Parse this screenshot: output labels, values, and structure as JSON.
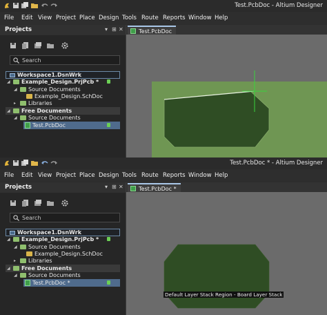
{
  "top": {
    "window_title": "Test.PcbDoc - Altium Designer",
    "menu": [
      "File",
      "Edit",
      "View",
      "Project",
      "Place",
      "Design",
      "Tools",
      "Route",
      "Reports",
      "Window",
      "Help"
    ],
    "panel": {
      "title": "Projects",
      "search_placeholder": "Search",
      "tree": {
        "workspace": "Workspace1.DsnWrk",
        "project": "Example_Design.PrjPcb *",
        "source_folder": "Source Documents",
        "schematic": "Example_Design.SchDoc",
        "libraries": "Libraries",
        "free_docs": "Free Documents",
        "free_source_folder": "Source Documents",
        "pcb": "Test.PcbDoc"
      }
    },
    "tab_label": "Test.PcbDoc"
  },
  "bottom": {
    "window_title": "Test.PcbDoc * - Altium Designer",
    "menu": [
      "File",
      "Edit",
      "View",
      "Project",
      "Place",
      "Design",
      "Tools",
      "Route",
      "Reports",
      "Window",
      "Help"
    ],
    "panel": {
      "title": "Projects",
      "search_placeholder": "Search",
      "tree": {
        "workspace": "Workspace1.DsnWrk",
        "project": "Example_Design.PrjPcb *",
        "source_folder": "Source Documents",
        "schematic": "Example_Design.SchDoc",
        "libraries": "Libraries",
        "free_docs": "Free Documents",
        "free_source_folder": "Source Documents",
        "pcb": "Test.PcbDoc *"
      }
    },
    "tab_label": "Test.PcbDoc *",
    "region_label": "Default Layer Stack Region - Board Layer Stack"
  },
  "colors": {
    "board_fill": "#2f4d24",
    "board_edge": "#86a96a",
    "board_area": "#6f9653",
    "canvas_bg": "#6b6b6b",
    "cursor": "#39d33c",
    "selection": "#4f6b8c"
  },
  "icons": [
    "app-icon",
    "save-icon",
    "save-all-icon",
    "open-icon",
    "undo-icon",
    "redo-icon",
    "dropdown-icon",
    "pin-icon",
    "close-icon",
    "search-icon",
    "gear-icon",
    "workspace-icon",
    "folder-icon",
    "schematic-icon",
    "pcb-icon",
    "lock-icon"
  ]
}
